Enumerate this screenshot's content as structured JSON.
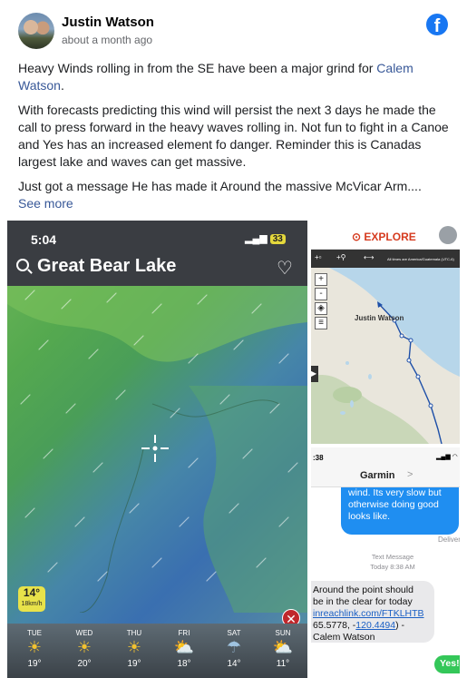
{
  "post": {
    "author": "Justin Watson",
    "timestamp": "about a month ago",
    "paragraph1": "Heavy Winds rolling in from the SE have been a major grind for ",
    "mention": "Calem Watson",
    "paragraph1_end": ".",
    "paragraph2": "With forecasts predicting this wind will persist the next 3 days he made the call to press forward in the heavy waves rolling in. Not fun to fight in a Canoe and Yes has an increased element fo danger. Reminder this is Canadas largest lake and waves can get massive.",
    "paragraph3": "Just got a message He has made it Around the massive McVicar Arm....",
    "see_more": "See more",
    "facebook_icon": "f"
  },
  "weather_app": {
    "status_time": "5:04",
    "battery": "33",
    "location": "Great Bear Lake",
    "current_temp": "14°",
    "wind_speed": "18km/h",
    "close_icon": "✕",
    "forecast": [
      {
        "day": "TUE",
        "temp": "19°",
        "icon": "sun-icon"
      },
      {
        "day": "WED",
        "temp": "20°",
        "icon": "sun-icon"
      },
      {
        "day": "THU",
        "temp": "19°",
        "icon": "sun-icon"
      },
      {
        "day": "FRI",
        "temp": "18°",
        "icon": "partly-cloudy-icon"
      },
      {
        "day": "SAT",
        "temp": "14°",
        "icon": "rain-icon"
      },
      {
        "day": "SUN",
        "temp": "11°",
        "icon": "partly-cloudy-icon"
      }
    ]
  },
  "explore_app": {
    "logo": "EXPLORE",
    "toolbar_note": "All times are America/Guatemala (UTC-6)",
    "place_label": "Justin Watson",
    "zoom_in": "+",
    "zoom_out": "-"
  },
  "messages_app": {
    "status_time": ":38",
    "contact": "Garmin",
    "chevron": ">",
    "outgoing": "wind.  Its very slow but otherwise doing good looks like.",
    "delivered": "Deliver",
    "meta_label": "Text Message",
    "meta_time": "Today 8:38 AM",
    "incoming_line1": "Around the point should",
    "incoming_line2": "be in the clear for today",
    "incoming_link": "inreachlink.com/FTKLHTB",
    "incoming_coords_pre": "65.5778, -",
    "incoming_coords_link": "120.4494",
    "incoming_coords_post": ") -",
    "incoming_signature": "Calem Watson",
    "reply": "Yes!!"
  },
  "colors": {
    "facebook_blue": "#1877f2",
    "link": "#385898",
    "imessage_blue": "#1f8ef1",
    "imessage_green": "#34c759",
    "explore_orange": "#d63b1f"
  }
}
